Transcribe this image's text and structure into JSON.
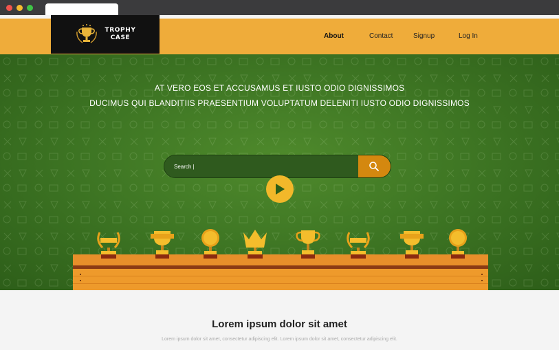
{
  "brand": {
    "logo_text_line1": "TROPHY",
    "logo_text_line2": "CASE"
  },
  "nav": [
    {
      "label": "About",
      "active": true
    },
    {
      "label": "Contact",
      "active": false
    },
    {
      "label": "Signup",
      "active": false
    },
    {
      "label": "Log In",
      "active": false
    }
  ],
  "hero": {
    "line1": "AT VERO EOS ET ACCUSAMUS ET IUSTO ODIO DIGNISSIMOS",
    "line2": "DUCIMUS QUI BLANDITIIS PRAESENTIUM VOLUPTATUM DELENITI IUSTO ODIO DIGNISSIMOS"
  },
  "search": {
    "placeholder": "Search |",
    "button_icon": "magnifier-icon"
  },
  "play_icon": "play-icon",
  "trophies": [
    "laurel-ribbon-trophy",
    "cup-trophy",
    "medal-trophy",
    "crown-trophy",
    "handled-cup-trophy",
    "laurel-ribbon-trophy",
    "cup-trophy",
    "medal-trophy"
  ],
  "content": {
    "title": "Lorem ipsum dolor sit amet",
    "text": "Lorem ipsum dolor sit amet, consectetur adipiscing elit. Lorem ipsum dolor sit amet, consectetur adipiscing elit."
  },
  "colors": {
    "header": "#efac3a",
    "hero_green": "#3f7724",
    "accent_orange": "#d4880f",
    "play_yellow": "#f2b82a",
    "shelf": "#ee9a2b"
  }
}
